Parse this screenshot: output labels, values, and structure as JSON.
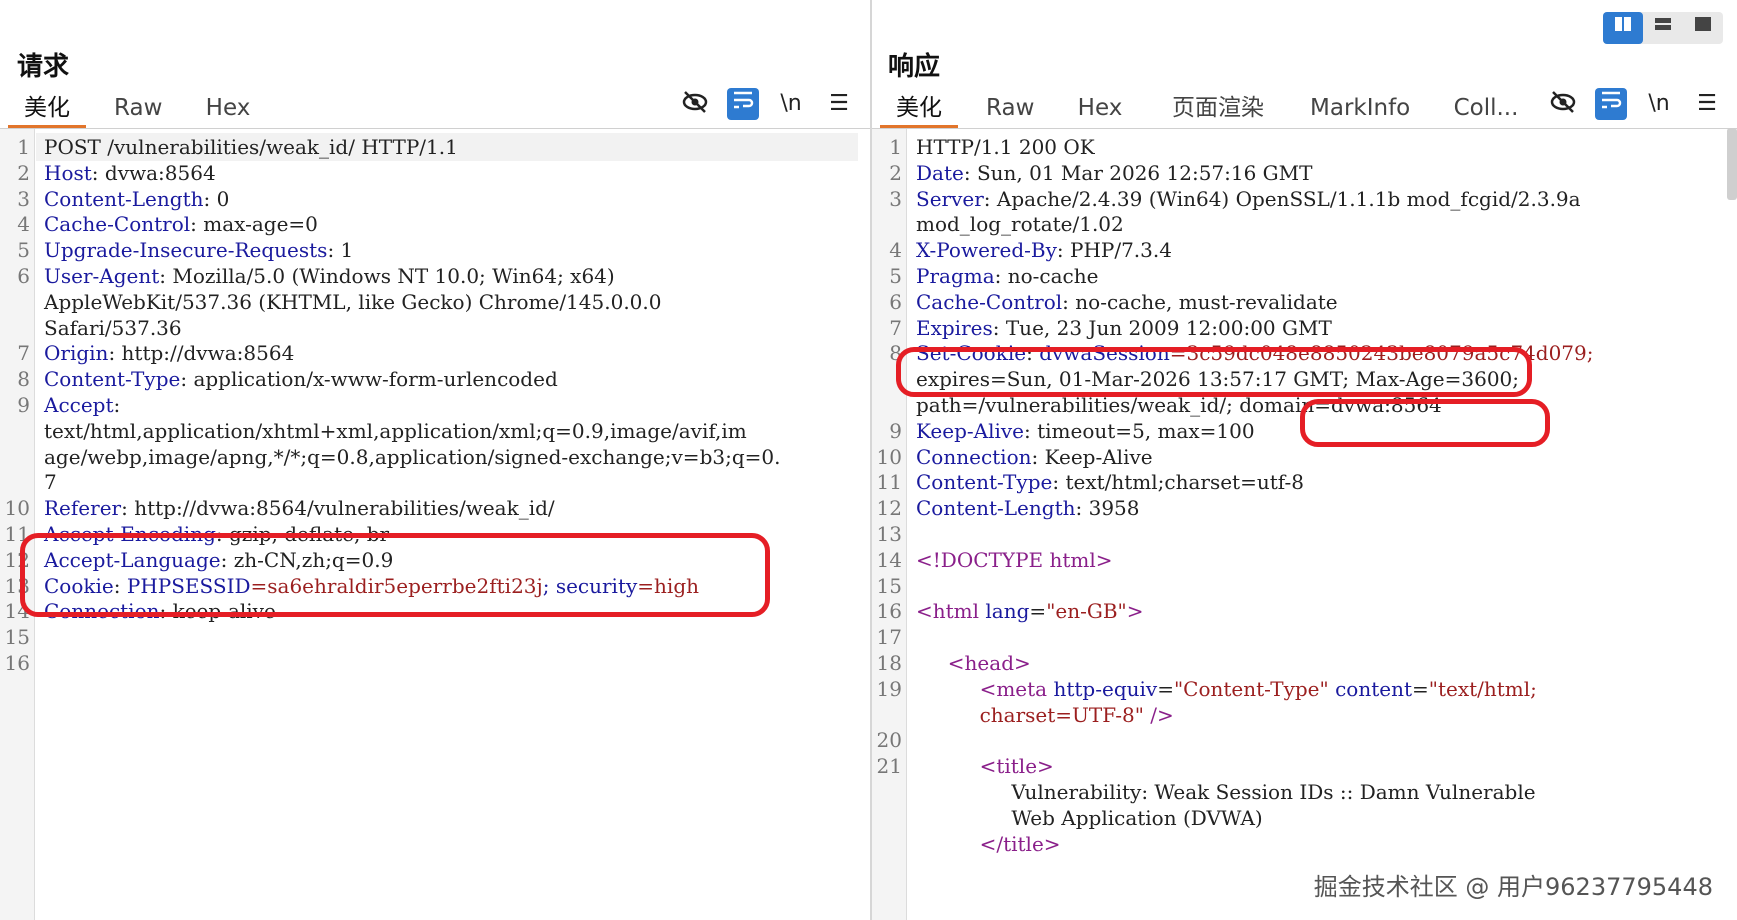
{
  "layout_buttons": [
    "split-horizontal",
    "split-vertical",
    "single"
  ],
  "request": {
    "title": "请求",
    "tabs": [
      "美化",
      "Raw",
      "Hex"
    ],
    "active_tab": "美化",
    "toolbar": {
      "hide": "eye-off-icon",
      "wrap": "word-wrap-icon",
      "newline": "\\n",
      "menu": "menu-icon"
    },
    "lines": [
      {
        "n": "1",
        "k": "",
        "v": "POST /vulnerabilities/weak_id/ HTTP/1.1"
      },
      {
        "n": "2",
        "k": "Host",
        "v": ": dvwa:8564"
      },
      {
        "n": "3",
        "k": "Content-Length",
        "v": ": 0"
      },
      {
        "n": "4",
        "k": "Cache-Control",
        "v": ": max-age=0"
      },
      {
        "n": "5",
        "k": "Upgrade-Insecure-Requests",
        "v": ": 1"
      },
      {
        "n": "6",
        "k": "User-Agent",
        "v": ": Mozilla/5.0 (Windows NT 10.0; Win64; x64)"
      },
      {
        "n": "",
        "k": "",
        "v": "AppleWebKit/537.36 (KHTML, like Gecko) Chrome/145.0.0.0"
      },
      {
        "n": "",
        "k": "",
        "v": "Safari/537.36"
      },
      {
        "n": "7",
        "k": "Origin",
        "v": ": http://dvwa:8564"
      },
      {
        "n": "8",
        "k": "Content-Type",
        "v": ": application/x-www-form-urlencoded"
      },
      {
        "n": "9",
        "k": "Accept",
        "v": ":"
      },
      {
        "n": "",
        "k": "",
        "v": "text/html,application/xhtml+xml,application/xml;q=0.9,image/avif,im"
      },
      {
        "n": "",
        "k": "",
        "v": "age/webp,image/apng,*/*;q=0.8,application/signed-exchange;v=b3;q=0."
      },
      {
        "n": "",
        "k": "",
        "v": "7"
      },
      {
        "n": "10",
        "k": "Referer",
        "v": ": http://dvwa:8564/vulnerabilities/weak_id/"
      },
      {
        "n": "11",
        "k": "Accept-Encoding",
        "v": ": gzip, deflate, br"
      },
      {
        "n": "12",
        "k": "Accept-Language",
        "v": ": zh-CN,zh;q=0.9"
      },
      {
        "n": "13",
        "k": "Cookie",
        "v": ": ",
        "cookie": [
          {
            "k": "PHPSESSID",
            "v": "=sa6ehraldir5eperrbe2fti23j"
          },
          {
            "k": "; security",
            "v": "=high"
          }
        ]
      },
      {
        "n": "14",
        "k": "Connection",
        "v": ": keep-alive"
      },
      {
        "n": "15",
        "k": "",
        "v": ""
      },
      {
        "n": "16",
        "k": "",
        "v": ""
      }
    ]
  },
  "response": {
    "title": "响应",
    "tabs": [
      "美化",
      "Raw",
      "Hex",
      "页面渲染",
      "MarkInfo",
      "Coll..."
    ],
    "active_tab": "美化",
    "lines": [
      {
        "n": "1",
        "k": "",
        "v": "HTTP/1.1 200 OK"
      },
      {
        "n": "2",
        "k": "Date",
        "v": ": Sun, 01 Mar 2026 12:57:16 GMT"
      },
      {
        "n": "3",
        "k": "Server",
        "v": ": Apache/2.4.39 (Win64) OpenSSL/1.1.1b mod_fcgid/2.3.9a"
      },
      {
        "n": "",
        "k": "",
        "v": "mod_log_rotate/1.02"
      },
      {
        "n": "4",
        "k": "X-Powered-By",
        "v": ": PHP/7.3.4"
      },
      {
        "n": "5",
        "k": "Pragma",
        "v": ": no-cache"
      },
      {
        "n": "6",
        "k": "Cache-Control",
        "v": ": no-cache, must-revalidate"
      },
      {
        "n": "7",
        "k": "Expires",
        "v": ": Tue, 23 Jun 2009 12:00:00 GMT"
      },
      {
        "n": "8",
        "k": "Set-Cookie",
        "v": ": ",
        "cookie": [
          {
            "k": "dvwaSession",
            "v": "=3c59dc048e8850243be8079a5c74d079;"
          }
        ]
      },
      {
        "n": "",
        "k": "",
        "v": "expires=Sun, 01-Mar-2026 13:57:17 GMT; Max-Age=3600;"
      },
      {
        "n": "",
        "k": "",
        "v": "path=/vulnerabilities/weak_id/; domain=dvwa:8564"
      },
      {
        "n": "9",
        "k": "Keep-Alive",
        "v": ": timeout=5, max=100"
      },
      {
        "n": "10",
        "k": "Connection",
        "v": ": Keep-Alive"
      },
      {
        "n": "11",
        "k": "Content-Type",
        "v": ": text/html;charset=utf-8"
      },
      {
        "n": "12",
        "k": "Content-Length",
        "v": ": 3958"
      },
      {
        "n": "13",
        "k": "",
        "v": ""
      },
      {
        "n": "14",
        "html": [
          {
            "c": "tag",
            "t": "<!DOCTYPE html>"
          }
        ]
      },
      {
        "n": "15",
        "k": "",
        "v": ""
      },
      {
        "n": "16",
        "html": [
          {
            "c": "tag",
            "t": "<html"
          },
          {
            "c": "attr",
            "t": " lang"
          },
          {
            "c": "",
            "t": "="
          },
          {
            "c": "str",
            "t": "\"en-GB\""
          },
          {
            "c": "tag",
            "t": ">"
          }
        ]
      },
      {
        "n": "17",
        "k": "",
        "v": ""
      },
      {
        "n": "18",
        "html": [
          {
            "c": "",
            "t": "     "
          },
          {
            "c": "tag",
            "t": "<head>"
          }
        ]
      },
      {
        "n": "19",
        "html": [
          {
            "c": "",
            "t": "          "
          },
          {
            "c": "tag",
            "t": "<meta"
          },
          {
            "c": "attr",
            "t": " http-equiv"
          },
          {
            "c": "",
            "t": "="
          },
          {
            "c": "str",
            "t": "\"Content-Type\""
          },
          {
            "c": "attr",
            "t": " content"
          },
          {
            "c": "",
            "t": "="
          },
          {
            "c": "str",
            "t": "\"text/html;"
          }
        ]
      },
      {
        "n": "",
        "html": [
          {
            "c": "",
            "t": "          "
          },
          {
            "c": "str",
            "t": "charset=UTF-8\""
          },
          {
            "c": "",
            "t": " "
          },
          {
            "c": "tag",
            "t": "/>"
          }
        ]
      },
      {
        "n": "20",
        "k": "",
        "v": ""
      },
      {
        "n": "21",
        "html": [
          {
            "c": "",
            "t": "          "
          },
          {
            "c": "tag",
            "t": "<title>"
          }
        ]
      },
      {
        "n": "",
        "k": "",
        "v": "               Vulnerability: Weak Session IDs :: Damn Vulnerable"
      },
      {
        "n": "",
        "k": "",
        "v": "               Web Application (DVWA)"
      },
      {
        "n": "",
        "html": [
          {
            "c": "",
            "t": "          "
          },
          {
            "c": "tag",
            "t": "</title>"
          }
        ]
      }
    ]
  },
  "watermark": "掘金技术社区 @ 用户96237795448"
}
